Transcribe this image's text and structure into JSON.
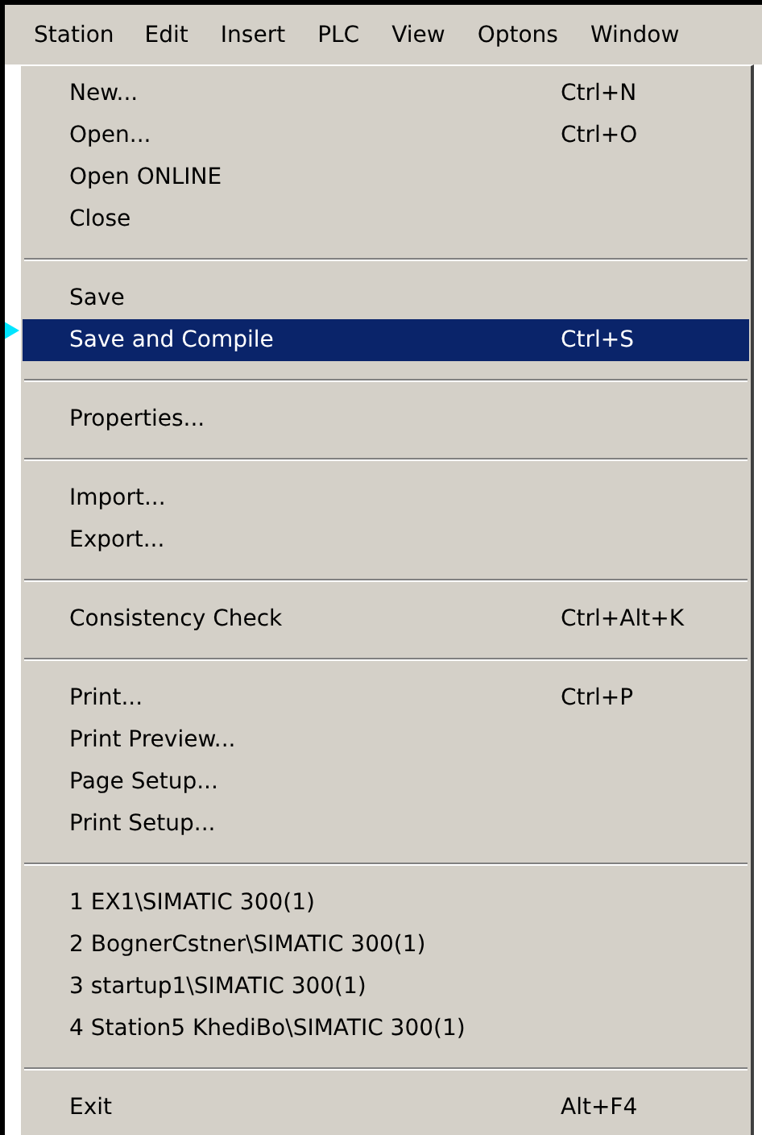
{
  "menubar": [
    {
      "label": "Station",
      "selected": true
    },
    {
      "label": "Edit",
      "selected": false
    },
    {
      "label": "Insert",
      "selected": false
    },
    {
      "label": "PLC",
      "selected": false
    },
    {
      "label": "View",
      "selected": false
    },
    {
      "label": "Optons",
      "selected": false
    },
    {
      "label": "Window",
      "selected": false
    }
  ],
  "menu": [
    {
      "kind": "item",
      "label": "New...",
      "shortcut": "Ctrl+N",
      "selected": false
    },
    {
      "kind": "item",
      "label": "Open...",
      "shortcut": "Ctrl+O",
      "selected": false
    },
    {
      "kind": "item",
      "label": "Open ONLINE",
      "selected": false
    },
    {
      "kind": "item",
      "label": "Close",
      "selected": false
    },
    {
      "kind": "separator"
    },
    {
      "kind": "item",
      "label": "Save",
      "selected": false
    },
    {
      "kind": "item",
      "label": "Save and Compile",
      "shortcut": "Ctrl+S",
      "selected": true
    },
    {
      "kind": "separator"
    },
    {
      "kind": "item",
      "label": "Properties...",
      "selected": false
    },
    {
      "kind": "separator"
    },
    {
      "kind": "item",
      "label": "Import...",
      "selected": false
    },
    {
      "kind": "item",
      "label": "Export...",
      "selected": false
    },
    {
      "kind": "separator"
    },
    {
      "kind": "item",
      "label": "Consistency Check",
      "shortcut": "Ctrl+Alt+K",
      "selected": false
    },
    {
      "kind": "separator"
    },
    {
      "kind": "item",
      "label": "Print...",
      "shortcut": "Ctrl+P",
      "selected": false
    },
    {
      "kind": "item",
      "label": "Print Preview...",
      "selected": false
    },
    {
      "kind": "item",
      "label": "Page Setup...",
      "selected": false
    },
    {
      "kind": "item",
      "label": "Print Setup...",
      "selected": false
    },
    {
      "kind": "separator"
    },
    {
      "kind": "item",
      "label": "1 EX1\\SIMATIC 300(1)",
      "selected": false
    },
    {
      "kind": "item",
      "label": "2 BognerCstner\\SIMATIC 300(1)",
      "selected": false
    },
    {
      "kind": "item",
      "label": "3 startup1\\SIMATIC 300(1)",
      "selected": false
    },
    {
      "kind": "item",
      "label": "4 Station5 KhediBo\\SIMATIC 300(1)",
      "selected": false
    },
    {
      "kind": "separator"
    },
    {
      "kind": "item",
      "label": "Exit",
      "shortcut": "Alt+F4",
      "selected": false
    }
  ]
}
